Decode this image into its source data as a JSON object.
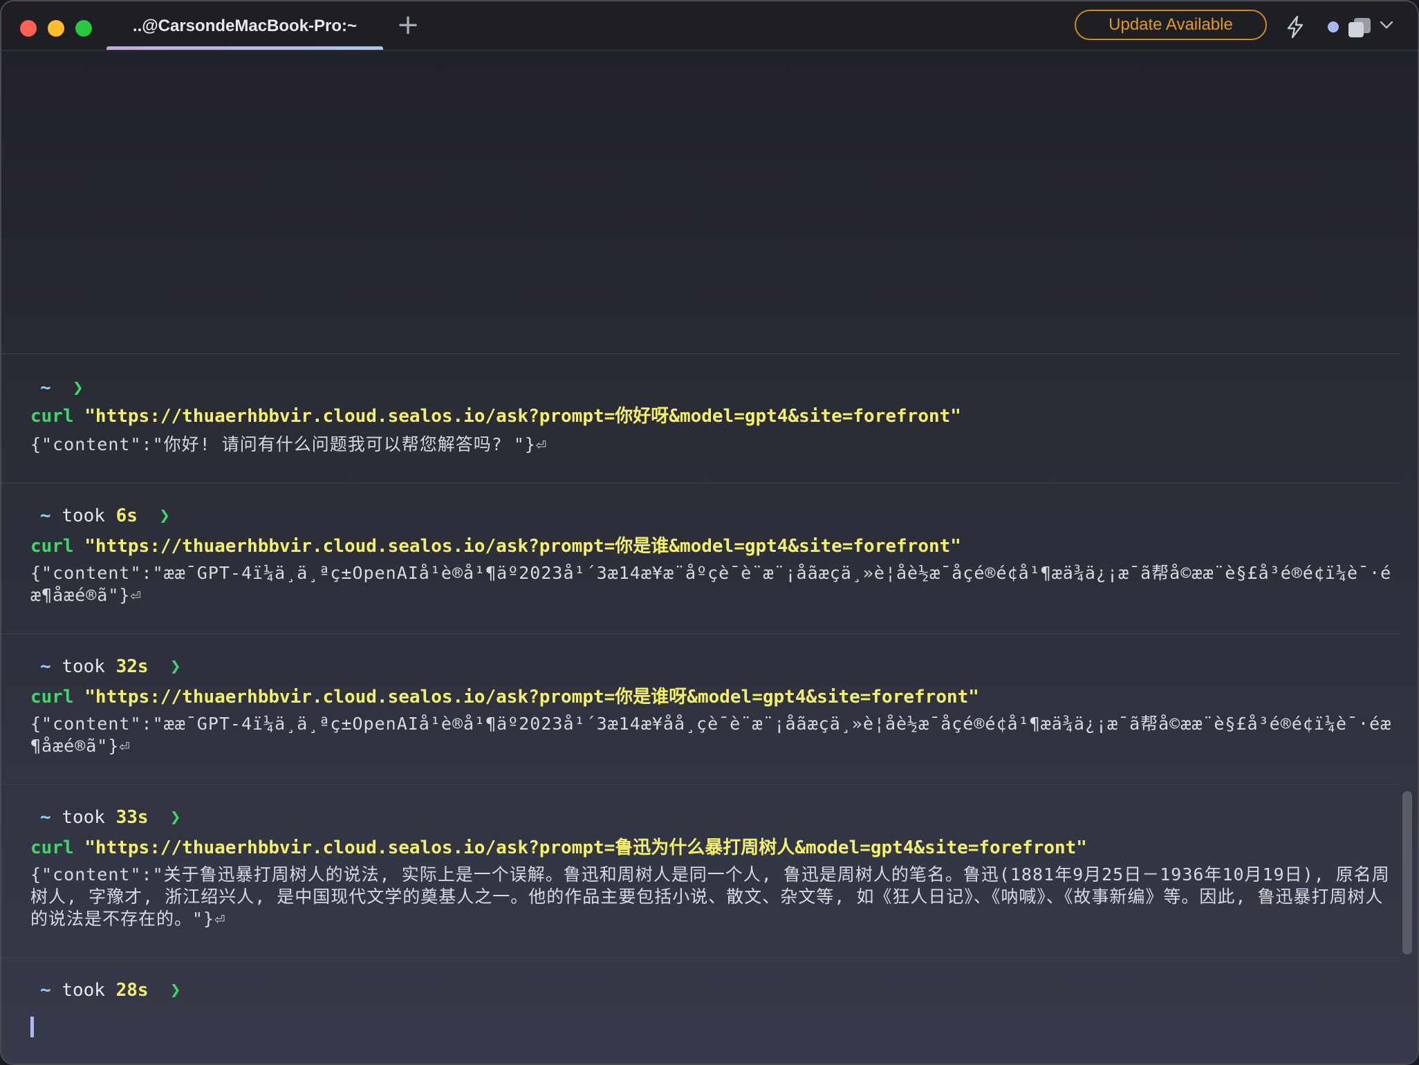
{
  "titlebar": {
    "tab_title": "..@CarsondeMacBook-Pro:~",
    "new_tab_symbol": "+",
    "update_label": "Update Available"
  },
  "colors": {
    "accent_update": "#e39a1c",
    "prompt_arrow": "#41d66a",
    "url_yellow": "#f5f06a",
    "tilde_blue": "#8fd0ff"
  },
  "icons": {
    "close": "red-dot",
    "minimize": "yellow-dot",
    "zoom": "green-dot",
    "bolt": "lightning-bolt-icon",
    "layers": "layers-icon",
    "chevron": "chevron-down-icon"
  },
  "blocks": [
    {
      "tilde": "~",
      "took": "",
      "duration": "",
      "arrow": "❯",
      "cmd": "curl",
      "arg": "\"https://thuaerhbbvir.cloud.sealos.io/ask?prompt=你好呀&model=gpt4&site=forefront\"",
      "output": "{\"content\":\"你好! 请问有什么问题我可以帮您解答吗? \"}⏎"
    },
    {
      "tilde": "~",
      "took": "took",
      "duration": "6s",
      "arrow": "❯",
      "cmd": "curl",
      "arg": "\"https://thuaerhbbvir.cloud.sealos.io/ask?prompt=你是谁&model=gpt4&site=forefront\"",
      "output": "{\"content\":\"ææ¯GPT-4ï¼ä¸ä¸ªç±OpenAIå¹è®­å¹¶äº2023å¹´3æ14æ¥æ¨åºçè¯è¨æ¨¡åãæçä¸»è¦åè½æ¯åç­é®é¢å¹¶æä¾ä¿¡æ¯ã帮å©ææ¨è§£å³é®é¢ï¼è¯·éæ¶åæé®ã\"}⏎"
    },
    {
      "tilde": "~",
      "took": "took",
      "duration": "32s",
      "arrow": "❯",
      "cmd": "curl",
      "arg": "\"https://thuaerhbbvir.cloud.sealos.io/ask?prompt=你是谁呀&model=gpt4&site=forefront\"",
      "output": "{\"content\":\"ææ¯GPT-4ï¼ä¸ä¸ªç±OpenAIå¹è®­å¹¶äº2023å¹´3æ14æ¥åå¸çè¯è¨æ¨¡åãæçä¸»è¦åè½æ¯åç­é®é¢å¹¶æä¾ä¿¡æ¯ã帮å©ææ¨è§£å³é®é¢ï¼è¯·éæ¶åæé®ã\"}⏎"
    },
    {
      "tilde": "~",
      "took": "took",
      "duration": "33s",
      "arrow": "❯",
      "cmd": "curl",
      "arg": "\"https://thuaerhbbvir.cloud.sealos.io/ask?prompt=鲁迅为什么暴打周树人&model=gpt4&site=forefront\"",
      "output": "{\"content\":\"关于鲁迅暴打周树人的说法, 实际上是一个误解。鲁迅和周树人是同一个人, 鲁迅是周树人的笔名。鲁迅(1881年9月25日－1936年10月19日), 原名周树人, 字豫才, 浙江绍兴人, 是中国现代文学的奠基人之一。他的作品主要包括小说、散文、杂文等, 如《狂人日记》、《呐喊》、《故事新编》等。因此, 鲁迅暴打周树人的说法是不存在的。\"}⏎"
    }
  ],
  "current_prompt": {
    "tilde": "~",
    "took": "took",
    "duration": "28s",
    "arrow": "❯"
  }
}
